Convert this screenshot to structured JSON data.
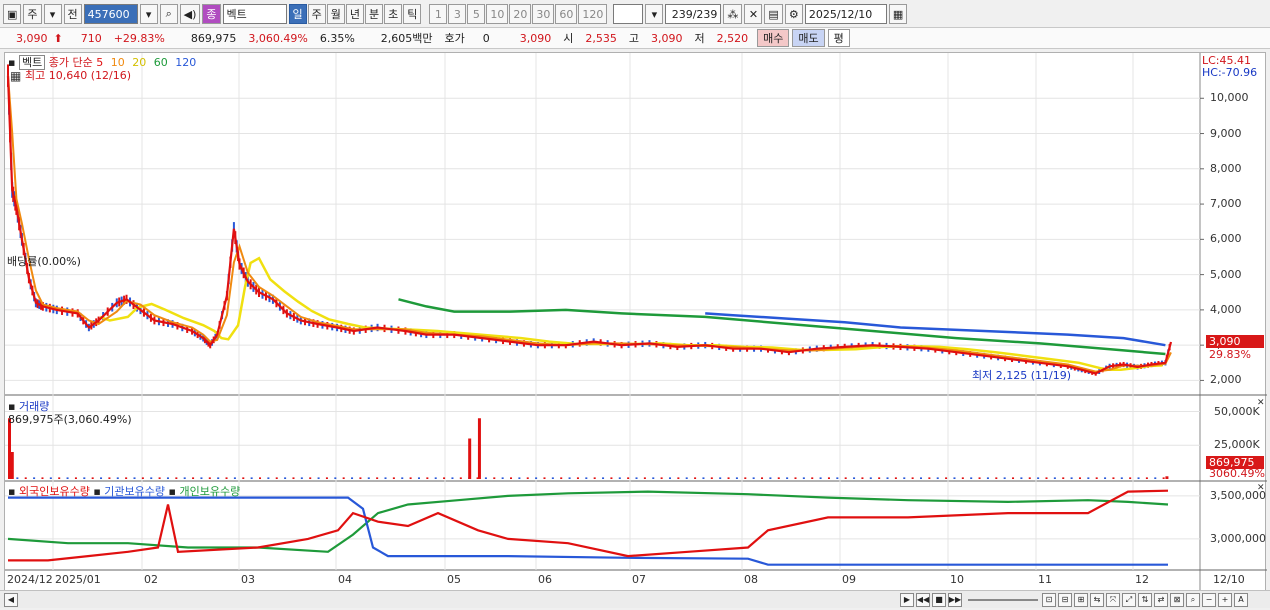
{
  "toolbar": {
    "period_type": "주",
    "prev_label": "전",
    "code": "457600",
    "name": "벡트",
    "badge": "종",
    "periods": [
      "일",
      "주",
      "월",
      "년",
      "분",
      "초",
      "틱"
    ],
    "active_period": "일",
    "intervals": [
      "1",
      "3",
      "5",
      "10",
      "20",
      "30",
      "60",
      "120"
    ],
    "count": "239/239",
    "date": "2025/12/10"
  },
  "quote": {
    "price": "3,090",
    "change": "710",
    "change_pct": "+29.83%",
    "volume": "869,975",
    "volume_pct": "3,060.49%",
    "turnover_pct": "6.35%",
    "amount": "2,605백만",
    "hoga_label": "호가",
    "hoga_value": "0",
    "price2": "3,090",
    "open_label": "시",
    "open": "2,535",
    "high_label": "고",
    "high": "3,090",
    "low_label": "저",
    "low": "2,520",
    "buy": "매수",
    "sell": "매도",
    "eval": "평"
  },
  "price_panel": {
    "name": "벡트",
    "ma_label": "종가 단순",
    "ma_periods": [
      "5",
      "10",
      "20",
      "60",
      "120"
    ],
    "ma_colors": [
      "#e01010",
      "#f08a10",
      "#f0e010",
      "#1e9a3a",
      "#2858d8"
    ],
    "high_mark": "최고 10,640 (12/16)",
    "low_mark": "최저 2,125 (11/19)",
    "dividend": "배당률(0.00%)",
    "lc": "LC:45.41",
    "hc": "HC:-70.96",
    "last_price": "3,090",
    "last_pct": "29.83%"
  },
  "volume_panel": {
    "title": "거래량",
    "info": "869,975주(3,060.49%)",
    "last": "869,975",
    "last_pct": "3060.49%"
  },
  "holding_panel": {
    "series_labels": [
      "외국인보유수량",
      "기관보유수량",
      "개인보유수량"
    ],
    "series_colors": [
      "#e01010",
      "#2858d8",
      "#1e9a3a"
    ]
  },
  "x_axis": [
    "2024/12",
    "2025/01",
    "02",
    "03",
    "04",
    "05",
    "06",
    "07",
    "08",
    "09",
    "10",
    "11",
    "12"
  ],
  "x_right_label": "12/10",
  "chart_data": [
    {
      "type": "line",
      "title": "",
      "y_ticks": [
        10000,
        9000,
        8000,
        7000,
        6000,
        5000,
        4000,
        3000,
        2000
      ],
      "ylim": [
        1700,
        11000
      ],
      "x_count": 239,
      "series": [
        {
          "name": "종가",
          "points": [
            [
              0,
              10640
            ],
            [
              3,
              7400
            ],
            [
              6,
              6900
            ],
            [
              10,
              6000
            ],
            [
              15,
              4900
            ],
            [
              20,
              4200
            ],
            [
              25,
              4100
            ],
            [
              35,
              4000
            ],
            [
              50,
              3900
            ],
            [
              58,
              3500
            ],
            [
              65,
              3700
            ],
            [
              78,
              4200
            ],
            [
              85,
              4300
            ],
            [
              95,
              4000
            ],
            [
              105,
              3700
            ],
            [
              118,
              3600
            ],
            [
              132,
              3400
            ],
            [
              140,
              3200
            ],
            [
              145,
              3000
            ],
            [
              150,
              3300
            ],
            [
              157,
              4400
            ],
            [
              162,
              6300
            ],
            [
              166,
              5300
            ],
            [
              172,
              4800
            ],
            [
              180,
              4500
            ],
            [
              190,
              4300
            ],
            [
              200,
              3900
            ],
            [
              210,
              3700
            ],
            [
              222,
              3600
            ],
            [
              236,
              3500
            ],
            [
              248,
              3400
            ],
            [
              265,
              3500
            ],
            [
              285,
              3400
            ],
            [
              300,
              3300
            ],
            [
              320,
              3300
            ],
            [
              340,
              3200
            ],
            [
              360,
              3100
            ],
            [
              380,
              3000
            ],
            [
              400,
              3000
            ],
            [
              420,
              3100
            ],
            [
              440,
              3000
            ],
            [
              460,
              3050
            ],
            [
              480,
              2950
            ],
            [
              500,
              3000
            ],
            [
              520,
              2900
            ],
            [
              540,
              2900
            ],
            [
              560,
              2800
            ],
            [
              580,
              2900
            ],
            [
              600,
              2950
            ],
            [
              620,
              3000
            ],
            [
              640,
              2950
            ],
            [
              660,
              2900
            ],
            [
              680,
              2800
            ],
            [
              700,
              2700
            ],
            [
              720,
              2600
            ],
            [
              740,
              2500
            ],
            [
              760,
              2400
            ],
            [
              770,
              2300
            ],
            [
              780,
              2200
            ],
            [
              790,
              2400
            ],
            [
              800,
              2450
            ],
            [
              810,
              2380
            ],
            [
              820,
              2450
            ],
            [
              830,
              2500
            ],
            [
              834,
              3090
            ]
          ]
        },
        {
          "name": "120",
          "points": [
            [
              500,
              3900
            ],
            [
              520,
              3850
            ],
            [
              560,
              3750
            ],
            [
              600,
              3650
            ],
            [
              640,
              3500
            ],
            [
              700,
              3400
            ],
            [
              760,
              3300
            ],
            [
              800,
              3200
            ],
            [
              830,
              3000
            ]
          ]
        },
        {
          "name": "60",
          "points": [
            [
              280,
              4300
            ],
            [
              300,
              4100
            ],
            [
              320,
              3950
            ],
            [
              360,
              3950
            ],
            [
              400,
              4000
            ],
            [
              440,
              3900
            ],
            [
              500,
              3800
            ],
            [
              560,
              3600
            ],
            [
              620,
              3400
            ],
            [
              680,
              3200
            ],
            [
              740,
              3050
            ],
            [
              800,
              2850
            ],
            [
              830,
              2750
            ]
          ]
        }
      ]
    },
    {
      "type": "bar",
      "title": "거래량",
      "y_ticks": [
        "50,000K",
        "25,000K"
      ],
      "spikes": [
        [
          0,
          45000
        ],
        [
          2,
          20000
        ],
        [
          330,
          30000
        ],
        [
          337,
          45000
        ],
        [
          830,
          2000
        ]
      ]
    },
    {
      "type": "line",
      "title": "보유수량",
      "y_ticks": [
        3500000,
        3000000
      ],
      "series": [
        {
          "name": "외국인보유수량",
          "points": [
            [
              0,
              2750000
            ],
            [
              40,
              2750000
            ],
            [
              80,
              2800000
            ],
            [
              120,
              2850000
            ],
            [
              150,
              2900000
            ],
            [
              160,
              3400000
            ],
            [
              170,
              2850000
            ],
            [
              250,
              2900000
            ],
            [
              300,
              3000000
            ],
            [
              330,
              3100000
            ],
            [
              345,
              3300000
            ],
            [
              370,
              3200000
            ],
            [
              400,
              3150000
            ],
            [
              430,
              3300000
            ],
            [
              470,
              3100000
            ],
            [
              500,
              3000000
            ],
            [
              560,
              2950000
            ],
            [
              620,
              2800000
            ],
            [
              680,
              2850000
            ],
            [
              740,
              2900000
            ],
            [
              760,
              3100000
            ],
            [
              820,
              3250000
            ],
            [
              900,
              3250000
            ],
            [
              1000,
              3300000
            ],
            [
              1080,
              3300000
            ],
            [
              1120,
              3550000
            ],
            [
              1160,
              3560000
            ]
          ]
        },
        {
          "name": "기관보유수량",
          "points": [
            [
              0,
              3480000
            ],
            [
              340,
              3480000
            ],
            [
              355,
              3350000
            ],
            [
              365,
              2900000
            ],
            [
              380,
              2800000
            ],
            [
              500,
              2800000
            ],
            [
              620,
              2780000
            ],
            [
              740,
              2770000
            ],
            [
              760,
              2700000
            ],
            [
              1160,
              2700000
            ]
          ]
        },
        {
          "name": "개인보유수량",
          "points": [
            [
              0,
              3000000
            ],
            [
              60,
              2950000
            ],
            [
              120,
              2950000
            ],
            [
              180,
              2900000
            ],
            [
              250,
              2900000
            ],
            [
              320,
              2850000
            ],
            [
              345,
              3050000
            ],
            [
              370,
              3300000
            ],
            [
              400,
              3400000
            ],
            [
              450,
              3450000
            ],
            [
              500,
              3500000
            ],
            [
              560,
              3530000
            ],
            [
              640,
              3550000
            ],
            [
              740,
              3520000
            ],
            [
              820,
              3480000
            ],
            [
              900,
              3450000
            ],
            [
              1000,
              3430000
            ],
            [
              1080,
              3450000
            ],
            [
              1120,
              3430000
            ],
            [
              1160,
              3400000
            ]
          ]
        }
      ]
    }
  ]
}
